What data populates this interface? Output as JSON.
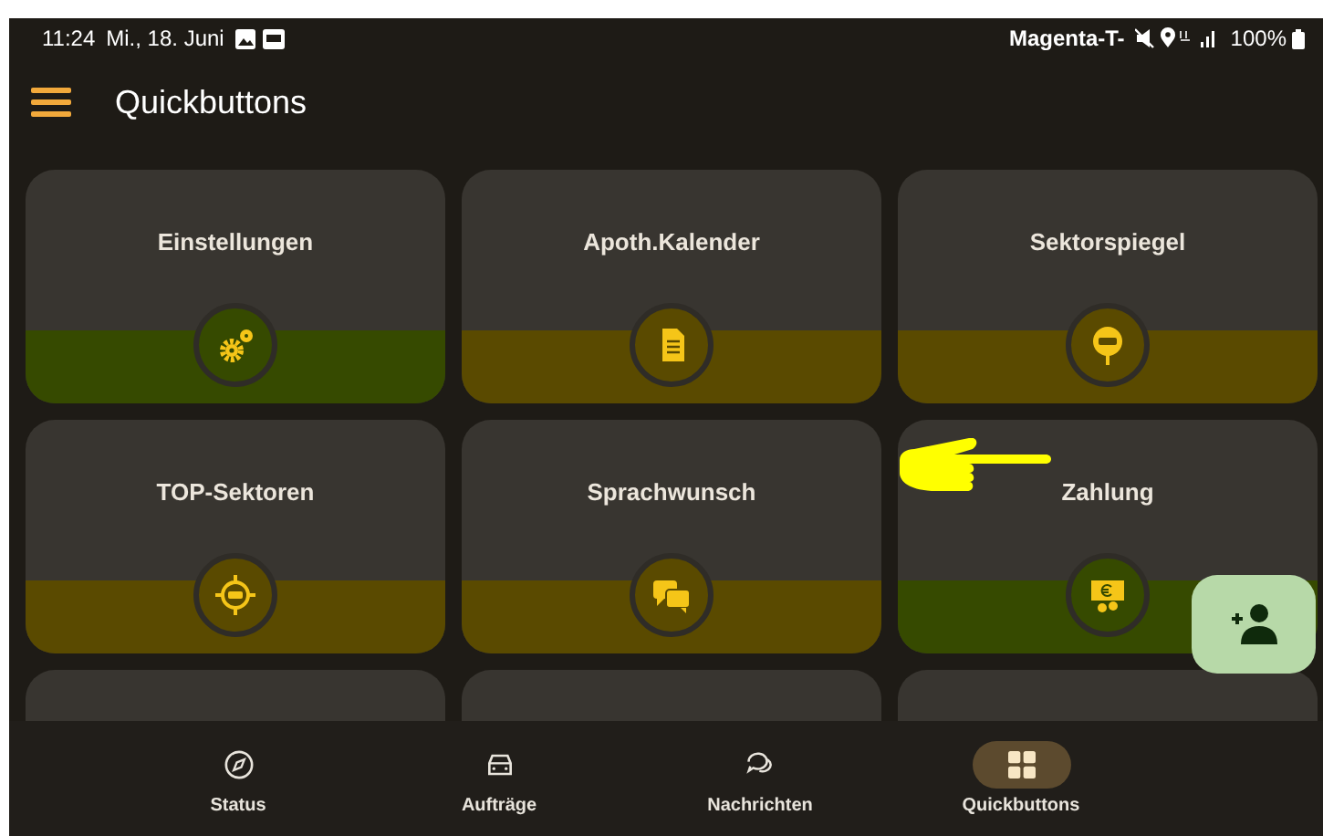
{
  "status_bar": {
    "time": "11:24",
    "date": "Mi., 18. Juni",
    "carrier": "Magenta-T-",
    "battery": "100%"
  },
  "app_bar": {
    "title": "Quickbuttons"
  },
  "tiles": [
    {
      "kind": "full",
      "label": "Einstellungen",
      "color": "#364a00"
    },
    {
      "kind": "full",
      "label": "Apoth.Kalender",
      "color": "#5a4a00"
    },
    {
      "kind": "full",
      "label": "Sektorspiegel",
      "color": "#5a4a00"
    },
    {
      "kind": "full",
      "label": "TOP-Sektoren",
      "color": "#5a4a00"
    },
    {
      "kind": "full",
      "label": "Sprachwunsch",
      "color": "#5a4a00"
    },
    {
      "kind": "full",
      "label": "Zahlung",
      "color": "#364a00"
    },
    {
      "kind": "cut"
    },
    {
      "kind": "cut"
    },
    {
      "kind": "cut"
    }
  ],
  "nav": [
    {
      "label": "Status",
      "selected": false
    },
    {
      "label": "Aufträge",
      "selected": false
    },
    {
      "label": "Nachrichten",
      "selected": false
    },
    {
      "label": "Quickbuttons",
      "selected": true
    }
  ]
}
